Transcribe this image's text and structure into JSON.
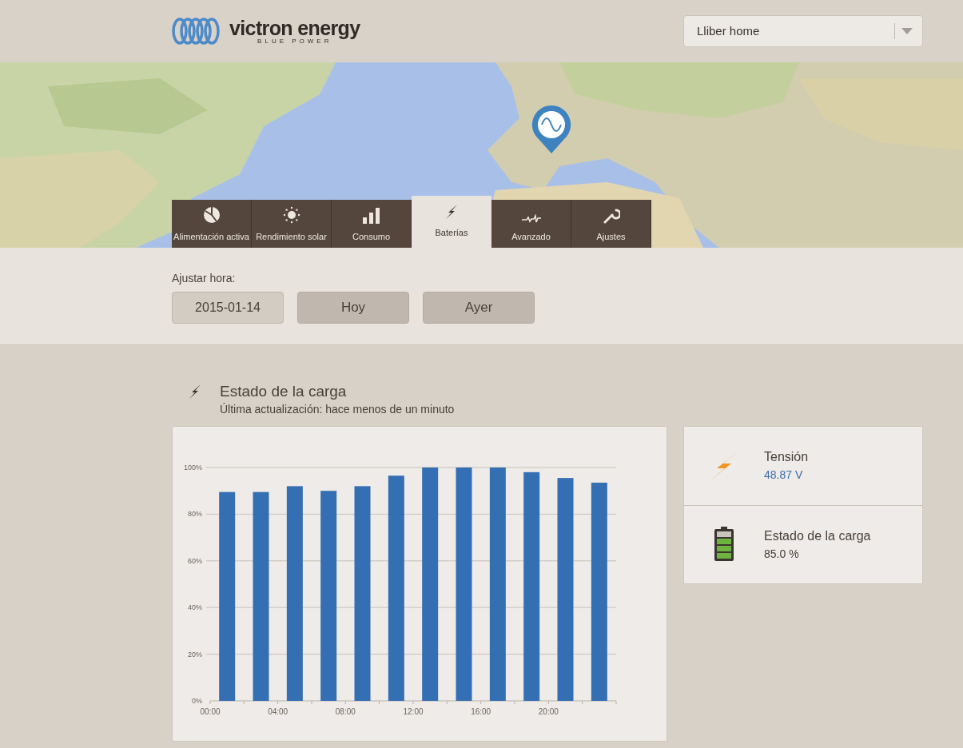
{
  "header": {
    "logo": {
      "name": "victron energy",
      "tagline": "BLUE POWER"
    },
    "site_select": {
      "value": "Lliber home"
    }
  },
  "tabs": [
    {
      "label": "Alimentación activa",
      "selected": false
    },
    {
      "label": "Rendimiento solar",
      "selected": false
    },
    {
      "label": "Consumo",
      "selected": false
    },
    {
      "label": "Baterías",
      "selected": true
    },
    {
      "label": "Avanzado",
      "selected": false
    },
    {
      "label": "Ajustes",
      "selected": false
    }
  ],
  "time": {
    "label": "Ajustar hora:",
    "date": "2015-01-14",
    "buttons": [
      "Hoy",
      "Ayer"
    ]
  },
  "section": {
    "title": "Estado de la carga",
    "subtitle": "Última actualización: hace menos de un minuto",
    "chart_data": {
      "type": "bar",
      "x": [
        1,
        3,
        5,
        7,
        9,
        11,
        13,
        15,
        17,
        19,
        21,
        23
      ],
      "series": [
        {
          "color": "#356fb3",
          "values": [
            89.5,
            89.5,
            92,
            90,
            92,
            96.5,
            100,
            100,
            100,
            98,
            95.5,
            93.5
          ]
        }
      ],
      "xlim": [
        0,
        24
      ],
      "ylim": [
        0,
        100
      ],
      "grid": true,
      "xticks": [
        {
          "value": 0,
          "label": "00:00"
        },
        {
          "value": 4,
          "label": "04:00"
        },
        {
          "value": 8,
          "label": "08:00"
        },
        {
          "value": 12,
          "label": "12:00"
        },
        {
          "value": 16,
          "label": "16:00"
        },
        {
          "value": 20,
          "label": "20:00"
        }
      ],
      "yticks": [
        {
          "value": 0,
          "label": "0%"
        },
        {
          "value": 20,
          "label": "20%"
        },
        {
          "value": 40,
          "label": "40%"
        },
        {
          "value": 60,
          "label": "60%"
        },
        {
          "value": 80,
          "label": "80%"
        },
        {
          "value": 100,
          "label": "100%"
        }
      ]
    }
  },
  "stats": [
    {
      "kind": "voltage",
      "label": "Tensión",
      "value": "48.87 V"
    },
    {
      "kind": "charge",
      "label": "Estado de la carga",
      "value": "85.0 %"
    }
  ]
}
